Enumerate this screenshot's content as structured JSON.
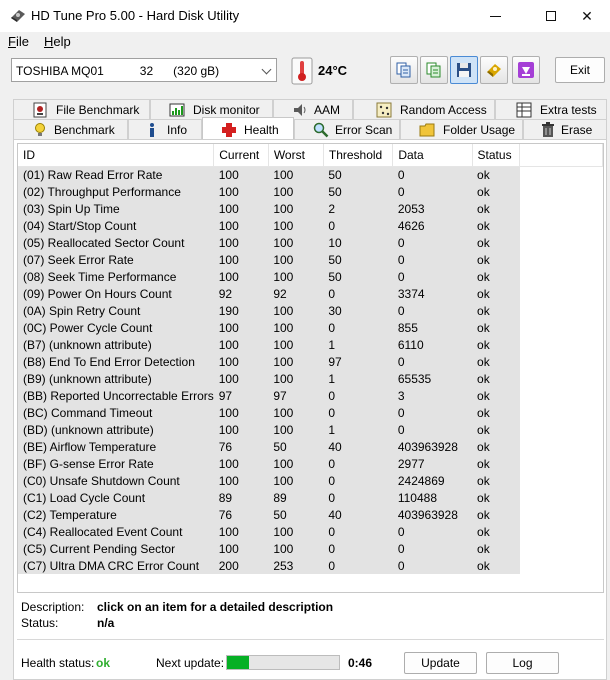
{
  "window": {
    "title": "HD Tune Pro 5.00 - Hard Disk Utility",
    "controls": {
      "minimize": "",
      "maximize": "",
      "close": "✕"
    }
  },
  "menu": [
    {
      "label": "File",
      "underline": "F",
      "rest": "ile"
    },
    {
      "label": "Help",
      "underline": "H",
      "rest": "elp"
    }
  ],
  "toolbar": {
    "drive_name": "TOSHIBA MQ01   32",
    "drive_capacity": "(320 gB)",
    "temperature": "24°C",
    "exit_label": "Exit"
  },
  "tabs_row1": [
    {
      "label": "File Benchmark",
      "icon": "file-benchmark-icon"
    },
    {
      "label": "Disk monitor",
      "icon": "disk-monitor-icon"
    },
    {
      "label": "AAM",
      "icon": "speaker-icon"
    },
    {
      "label": "Random Access",
      "icon": "random-access-icon"
    },
    {
      "label": "Extra tests",
      "icon": "extra-tests-icon"
    }
  ],
  "tabs_row2": [
    {
      "label": "Benchmark",
      "icon": "lightbulb-icon"
    },
    {
      "label": "Info",
      "icon": "info-icon"
    },
    {
      "label": "Health",
      "icon": "health-cross-icon",
      "active": true
    },
    {
      "label": "Error Scan",
      "icon": "magnifier-icon"
    },
    {
      "label": "Folder Usage",
      "icon": "folder-icon"
    },
    {
      "label": "Erase",
      "icon": "trash-icon"
    }
  ],
  "table": {
    "columns": [
      "ID",
      "Current",
      "Worst",
      "Threshold",
      "Data",
      "Status"
    ],
    "rows": [
      [
        "(01) Raw Read Error Rate",
        "100",
        "100",
        "50",
        "0",
        "ok"
      ],
      [
        "(02) Throughput Performance",
        "100",
        "100",
        "50",
        "0",
        "ok"
      ],
      [
        "(03) Spin Up Time",
        "100",
        "100",
        "2",
        "2053",
        "ok"
      ],
      [
        "(04) Start/Stop Count",
        "100",
        "100",
        "0",
        "4626",
        "ok"
      ],
      [
        "(05) Reallocated Sector Count",
        "100",
        "100",
        "10",
        "0",
        "ok"
      ],
      [
        "(07) Seek Error Rate",
        "100",
        "100",
        "50",
        "0",
        "ok"
      ],
      [
        "(08) Seek Time Performance",
        "100",
        "100",
        "50",
        "0",
        "ok"
      ],
      [
        "(09) Power On Hours Count",
        "92",
        "92",
        "0",
        "3374",
        "ok"
      ],
      [
        "(0A) Spin Retry Count",
        "190",
        "100",
        "30",
        "0",
        "ok"
      ],
      [
        "(0C) Power Cycle Count",
        "100",
        "100",
        "0",
        "855",
        "ok"
      ],
      [
        "(B7) (unknown attribute)",
        "100",
        "100",
        "1",
        "6110",
        "ok"
      ],
      [
        "(B8) End To End Error Detection",
        "100",
        "100",
        "97",
        "0",
        "ok"
      ],
      [
        "(B9) (unknown attribute)",
        "100",
        "100",
        "1",
        "65535",
        "ok"
      ],
      [
        "(BB) Reported Uncorrectable Errors",
        "97",
        "97",
        "0",
        "3",
        "ok"
      ],
      [
        "(BC) Command Timeout",
        "100",
        "100",
        "0",
        "0",
        "ok"
      ],
      [
        "(BD) (unknown attribute)",
        "100",
        "100",
        "1",
        "0",
        "ok"
      ],
      [
        "(BE) Airflow Temperature",
        "76",
        "50",
        "40",
        "403963928",
        "ok"
      ],
      [
        "(BF) G-sense Error Rate",
        "100",
        "100",
        "0",
        "2977",
        "ok"
      ],
      [
        "(C0) Unsafe Shutdown Count",
        "100",
        "100",
        "0",
        "2424869",
        "ok"
      ],
      [
        "(C1) Load Cycle Count",
        "89",
        "89",
        "0",
        "110488",
        "ok"
      ],
      [
        "(C2) Temperature",
        "76",
        "50",
        "40",
        "403963928",
        "ok"
      ],
      [
        "(C4) Reallocated Event Count",
        "100",
        "100",
        "0",
        "0",
        "ok"
      ],
      [
        "(C5) Current Pending Sector",
        "100",
        "100",
        "0",
        "0",
        "ok"
      ],
      [
        "(C7) Ultra DMA CRC Error Count",
        "200",
        "253",
        "0",
        "0",
        "ok"
      ]
    ]
  },
  "details": {
    "description_label": "Description:",
    "description_value": "click on an item for a detailed description",
    "status_label": "Status:",
    "status_value": "n/a"
  },
  "footer": {
    "health_label": "Health status:",
    "health_value": "ok",
    "next_update_label": "Next update:",
    "progress_fraction": 0.2,
    "countdown": "0:46",
    "update_label": "Update",
    "log_label": "Log"
  },
  "colors": {
    "health_ok": "#2fae2f",
    "progress": "#06b025",
    "selected_toolbar": "#cfe3f7",
    "row_shade": "#e3e3e3"
  }
}
